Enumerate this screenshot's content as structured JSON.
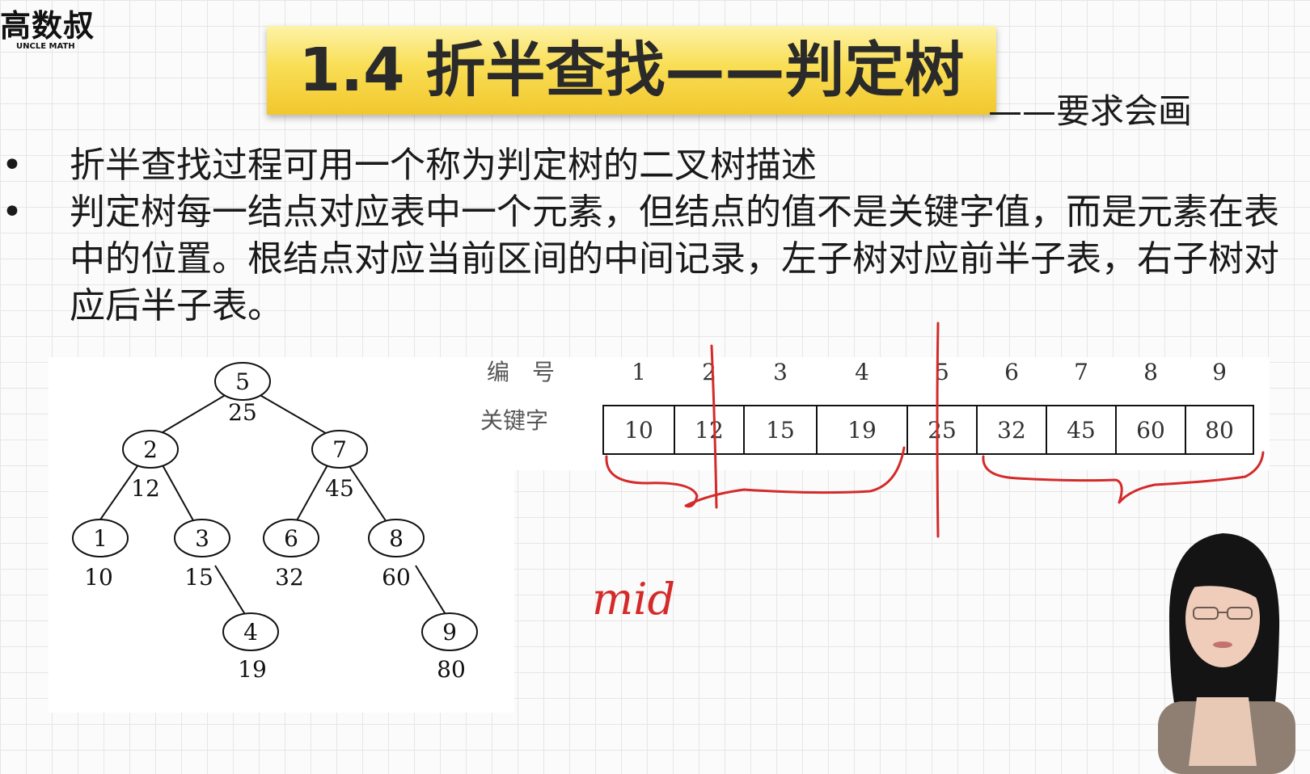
{
  "logo": {
    "cn": "高数叔",
    "en": "UNCLE MATH"
  },
  "title": "1.4 折半查找——判定树",
  "subtitle": "——要求会画",
  "bullets": [
    "折半查找过程可用一个称为判定树的二叉树描述",
    "判定树每一结点对应表中一个元素，但结点的值不是关键字值，而是元素在表中的位置。根结点对应当前区间的中间记录，左子树对应前半子表，右子树对应后半子表。"
  ],
  "bullet_symbol": "•",
  "tree": {
    "nodes": [
      {
        "id": "5",
        "key": "25"
      },
      {
        "id": "2",
        "key": "12"
      },
      {
        "id": "7",
        "key": "45"
      },
      {
        "id": "1",
        "key": "10"
      },
      {
        "id": "3",
        "key": "15"
      },
      {
        "id": "6",
        "key": "32"
      },
      {
        "id": "8",
        "key": "60"
      },
      {
        "id": "4",
        "key": "19"
      },
      {
        "id": "9",
        "key": "80"
      }
    ]
  },
  "table": {
    "row_labels": [
      "编　号",
      "关键字"
    ],
    "indices": [
      "1",
      "2",
      "3",
      "4",
      "5",
      "6",
      "7",
      "8",
      "9"
    ],
    "keys": [
      "10",
      "12",
      "15",
      "19",
      "25",
      "32",
      "45",
      "60",
      "80"
    ]
  },
  "annotation": {
    "text": "mid",
    "color": "#d42a2a"
  },
  "colors": {
    "banner": "#f9de55",
    "ink": "#d42a2a"
  }
}
